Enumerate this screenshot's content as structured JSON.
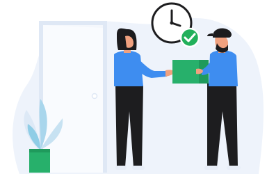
{
  "illustration": {
    "subject": "delivery-handoff",
    "icons": [
      "door-icon",
      "clock-icon",
      "check-icon",
      "package-icon",
      "plant-icon"
    ],
    "colors": {
      "background_blob": "#eef3fb",
      "door": "#f4f7fc",
      "door_frame": "#dfe8f5",
      "shirt": "#3e8df0",
      "pants": "#1d1d1f",
      "skin": "#f0a17f",
      "hair": "#1c1c1e",
      "package": "#27b06b",
      "check_badge": "#22b05b",
      "clock_stroke": "#1d1d1f",
      "plant_leaf": "#a9d6ec",
      "pot": "#27b06b"
    }
  }
}
